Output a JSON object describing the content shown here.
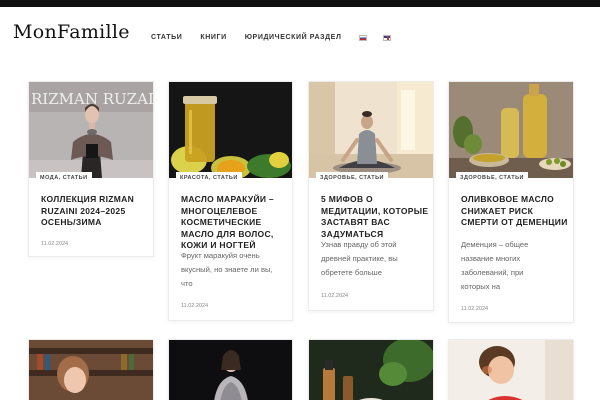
{
  "site": {
    "logo": "MonFamille",
    "nav": [
      "СТАТЬИ",
      "КНИГИ",
      "ЮРИДИЧЕСКИЙ РАЗДЕЛ"
    ],
    "languages": [
      "ru-flag-icon",
      "en-flag-icon"
    ]
  },
  "articles": [
    {
      "category": "МОДА, СТАТЬИ",
      "title": "КОЛЛЕКЦИЯ RIZMAN RUZAINI 2024–2025 ОСЕНЬ/ЗИМА",
      "excerpt": [],
      "date": "11.02.2024",
      "image_text": "RIZMAN RUZAI"
    },
    {
      "category": "КРАСОТА, СТАТЬИ",
      "title": "МАСЛО МАРАКУЙИ – МНОГОЦЕЛЕВОЕ КОСМЕТИЧЕСКИЕ МАСЛО ДЛЯ ВОЛОС, КОЖИ И НОГТЕЙ",
      "excerpt": [
        "Фрукт маракуйя очень",
        "вкусный, но знаете ли вы,",
        "что"
      ],
      "date": "11.02.2024"
    },
    {
      "category": "ЗДОРОВЬЕ, СТАТЬИ",
      "title": "5 МИФОВ О МЕДИТАЦИИ, КОТОРЫЕ ЗАСТАВЯТ ВАС ЗАДУМАТЬСЯ",
      "excerpt": [
        "Узнав правду об этой",
        "древней практике, вы",
        "обретете больше"
      ],
      "date": "11.02.2024"
    },
    {
      "category": "ЗДОРОВЬЕ, СТАТЬИ",
      "title": "ОЛИВКОВОЕ МАСЛО СНИЖАЕТ РИСК СМЕРТИ ОТ ДЕМЕНЦИИ",
      "excerpt": [
        "Деменция – общее",
        "название многих",
        "заболеваний, при",
        "которых на"
      ],
      "date": "11.02.2024"
    }
  ],
  "colors": {
    "topbar": "#111111",
    "text": "#222222",
    "muted": "#666666"
  }
}
